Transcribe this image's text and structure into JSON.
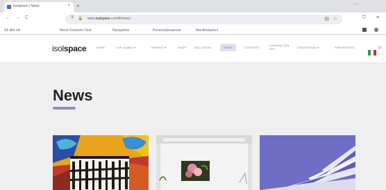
{
  "browser": {
    "tab_title": "Isolspace | News",
    "tab_close": "×",
    "new_tab": "+",
    "window_controls": "—",
    "nav_back": "←",
    "nav_forward": "→",
    "nav_reload": "C",
    "url_domain": "isolspace",
    "url_rest": ".com/it/news/",
    "url_prefix": "www.",
    "bookmarks": [
      "Gli altri siti",
      "Menù Gestione iTest",
      "Navigatore",
      "Personalizzazione",
      "Manifestazioni"
    ]
  },
  "site": {
    "logo_light": "isol",
    "logo_bold": "space",
    "menu": [
      "HOME",
      "CHI SIAMO ▾",
      "SERVIZI ▾",
      "SHOP",
      "SOLUZIONI",
      "NEWS",
      "CONTATTI",
      "LAVORA CON NOI",
      "CONTATTACI ▾",
      "PREVENTIVO"
    ],
    "active_menu": "NEWS",
    "lang": "IT"
  },
  "page": {
    "title": "News"
  },
  "colors": {
    "accent": "#8e8fcf",
    "active_menu_bg": "#dfe0f2"
  }
}
